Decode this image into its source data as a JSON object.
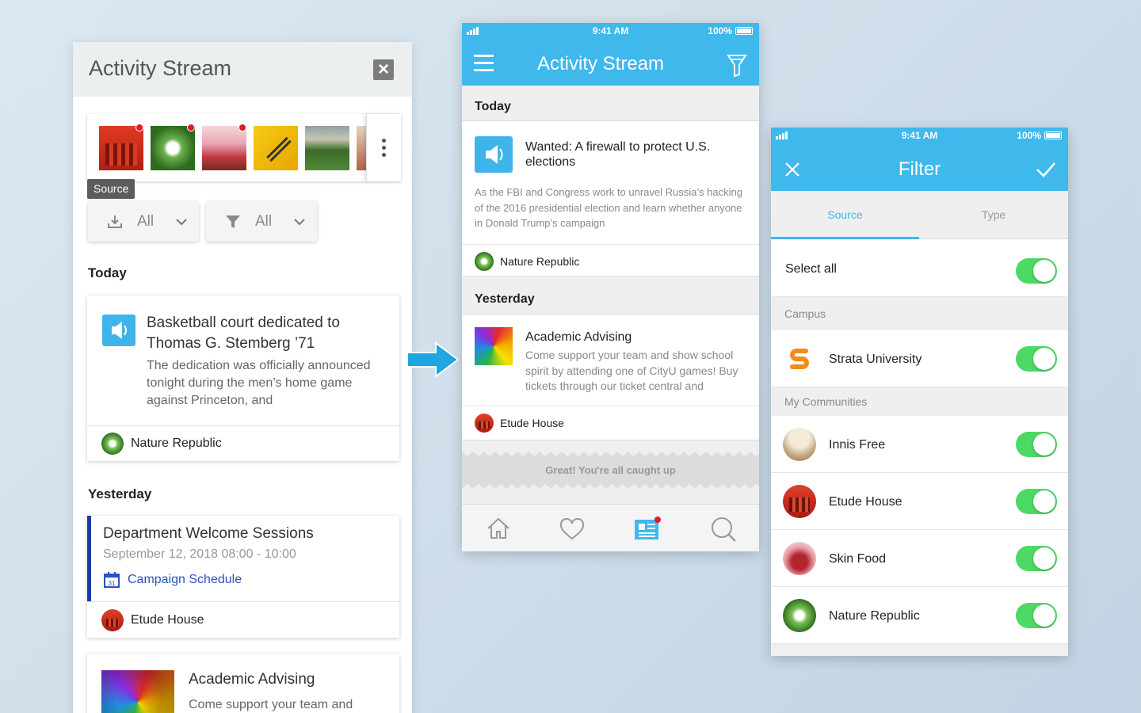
{
  "left_panel": {
    "title": "Activity Stream",
    "close_icon": "close-icon",
    "source_tooltip": "Source",
    "source_filter": {
      "label": "All",
      "icon": "download-icon"
    },
    "type_filter": {
      "label": "All",
      "icon": "funnel-icon"
    },
    "today_header": "Today",
    "yesterday_header": "Yesterday",
    "card1": {
      "title": "Basketball court dedicated to Thomas G. Stemberg ’71",
      "body": "The dedication was officially announced tonight during the men’s home game against Princeton, and",
      "source": "Nature Republic"
    },
    "card2": {
      "title": "Department Welcome Sessions",
      "datetime": "September 12, 2018 08:00 - 10:00",
      "link": "Campaign Schedule",
      "source": "Etude House"
    },
    "card3": {
      "title": "Academic Advising",
      "body": "Come support your team and"
    }
  },
  "mid_phone": {
    "status": {
      "time": "9:41 AM",
      "battery": "100%"
    },
    "title": "Activity Stream",
    "today_header": "Today",
    "yesterday_header": "Yesterday",
    "item1": {
      "title": "Wanted: A firewall to protect U.S. elections",
      "body": "As the FBI and Congress work to unravel Russia’s hacking of the 2016 presidential election and learn whether anyone in Donald Trump’s campaign",
      "source": "Nature Republic"
    },
    "item2": {
      "title": "Academic Advising",
      "body": "Come support your team and show school spirit by attending one of CityU games! Buy tickets through our ticket central and",
      "source": "Etude House"
    },
    "caught_up": "Great! You're all caught up",
    "tabs": [
      "home-icon",
      "heart-icon",
      "news-icon",
      "search-icon"
    ]
  },
  "right_phone": {
    "status": {
      "time": "9:41 AM",
      "battery": "100%"
    },
    "title": "Filter",
    "tab_source": "Source",
    "tab_type": "Type",
    "select_all": "Select all",
    "campus_header": "Campus",
    "campus_item": "Strata University",
    "communities_header": "My Communities",
    "communities": [
      "Innis Free",
      "Etude House",
      "Skin Food",
      "Nature Republic"
    ]
  },
  "colors": {
    "accent": "#3fb8ec",
    "toggle_on": "#4cd964",
    "notify_dot": "#e3192d",
    "link": "#2a52be"
  }
}
